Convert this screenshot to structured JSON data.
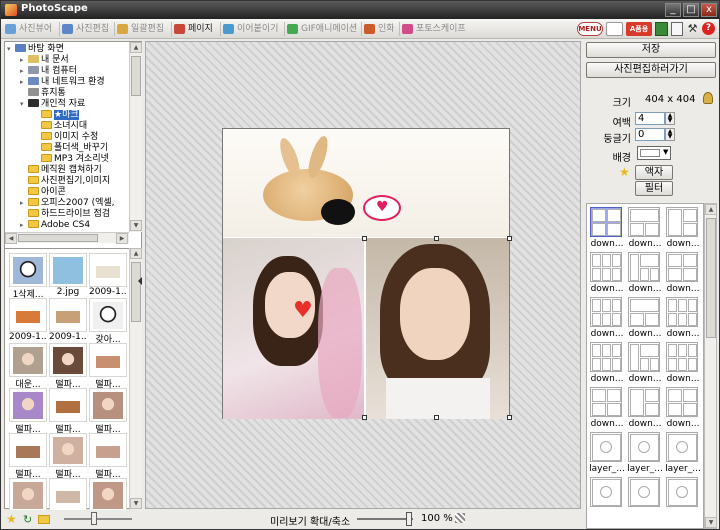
{
  "window": {
    "title": "PhotoScape",
    "controls": [
      "_",
      "□",
      "x"
    ]
  },
  "tabs": [
    {
      "label": "사진뷰어",
      "color": "#6aa0d8"
    },
    {
      "label": "사진편집",
      "color": "#5c86c8"
    },
    {
      "label": "일괄편집",
      "color": "#d9a640"
    },
    {
      "label": "페이지",
      "color": "#c8463a"
    },
    {
      "label": "이어붙이기",
      "color": "#4a9ad0"
    },
    {
      "label": "GIF애니메이션",
      "color": "#47a854"
    },
    {
      "label": "인화",
      "color": "#cc5a2a"
    },
    {
      "label": "포토스케이프",
      "color": "#d24b8a"
    }
  ],
  "toolbar_right": {
    "menu": "MENU",
    "blog": "A품용"
  },
  "tree": {
    "items": [
      {
        "label": "바탕 화면",
        "level": 0,
        "ex": "▾",
        "icon": "#5b7fc4"
      },
      {
        "label": "내 문서",
        "level": 1,
        "ex": "▸",
        "icon": "#e0c060"
      },
      {
        "label": "내 컴퓨터",
        "level": 1,
        "ex": "▸",
        "icon": "#8e98a8"
      },
      {
        "label": "내 네트워크 환경",
        "level": 1,
        "ex": "▸",
        "icon": "#6c8ac0"
      },
      {
        "label": "휴지통",
        "level": 1,
        "ex": "",
        "icon": "#909090"
      },
      {
        "label": "개인적 자료",
        "level": 1,
        "ex": "▾",
        "icon": "#2d2d2d"
      },
      {
        "label": "★마크",
        "level": 2,
        "ex": "",
        "icon": "#f2c744",
        "sel": true
      },
      {
        "label": "소녀시대",
        "level": 2,
        "ex": "",
        "icon": "#f2c744"
      },
      {
        "label": "이미지 수정",
        "level": 2,
        "ex": "",
        "icon": "#f2c744"
      },
      {
        "label": "폴더색_바꾸기",
        "level": 2,
        "ex": "",
        "icon": "#f2c744"
      },
      {
        "label": "MP3 겨소리넷",
        "level": 2,
        "ex": "",
        "icon": "#f2c744"
      },
      {
        "label": "메직원 캡쳐하기",
        "level": 1,
        "ex": "",
        "icon": "#f2c744"
      },
      {
        "label": "사진편집기,이미지",
        "level": 1,
        "ex": "",
        "icon": "#f2c744"
      },
      {
        "label": "아이콘",
        "level": 1,
        "ex": "",
        "icon": "#f2c744"
      },
      {
        "label": "오피스2007 (엑셀,",
        "level": 1,
        "ex": "▸",
        "icon": "#f2c744"
      },
      {
        "label": "하드드라이브 점검",
        "level": 1,
        "ex": "",
        "icon": "#f2c744"
      },
      {
        "label": "Adobe CS4",
        "level": 1,
        "ex": "▸",
        "icon": "#f2c744"
      }
    ]
  },
  "thumbs": [
    {
      "cap": "1삭제...",
      "color": "#9fb8d8",
      "kind": "panda"
    },
    {
      "cap": "2.jpg",
      "color": "#8fc0e0",
      "kind": "blue"
    },
    {
      "cap": "2009-1...",
      "color": "#e8e0d0",
      "kind": "small"
    },
    {
      "cap": "2009-1...",
      "color": "#d87a3a",
      "kind": "small"
    },
    {
      "cap": "2009-1...",
      "color": "#c8a078",
      "kind": "small"
    },
    {
      "cap": "갖아...",
      "color": "#f0f0f0",
      "kind": "panda"
    },
    {
      "cap": "대운...",
      "color": "#b0a090",
      "kind": "face"
    },
    {
      "cap": "떨파...",
      "color": "#6a4a3a",
      "kind": "face"
    },
    {
      "cap": "떨파...",
      "color": "#c89070",
      "kind": "small"
    },
    {
      "cap": "떨파...",
      "color": "#a888c8",
      "kind": "face"
    },
    {
      "cap": "떨파...",
      "color": "#b07040",
      "kind": "small"
    },
    {
      "cap": "떨파...",
      "color": "#b89080",
      "kind": "face"
    },
    {
      "cap": "떨파...",
      "color": "#a87858",
      "kind": "small"
    },
    {
      "cap": "떨파...",
      "color": "#d0b0a0",
      "kind": "face"
    },
    {
      "cap": "떨파...",
      "color": "#c8a090",
      "kind": "small"
    },
    {
      "cap": "",
      "color": "#c8a898",
      "kind": "face"
    },
    {
      "cap": "",
      "color": "#d0b8a8",
      "kind": "small"
    },
    {
      "cap": "",
      "color": "#c09888",
      "kind": "face"
    }
  ],
  "right": {
    "save": "저장",
    "goto_edit": "사진편집하러가기",
    "size_label": "크기",
    "size_value": "404 x 404",
    "margin_label": "여백",
    "margin_value": "4",
    "round_label": "둥글기",
    "round_value": "0",
    "bg_label": "배경",
    "frame_btn": "액자",
    "filter_btn": "필터",
    "layouts": [
      {
        "cap": "down...",
        "pat": "g4",
        "sel": true
      },
      {
        "cap": "down...",
        "pat": "g3"
      },
      {
        "cap": "down...",
        "pat": "g3b"
      },
      {
        "cap": "down...",
        "pat": "g6"
      },
      {
        "cap": "down...",
        "pat": "g4b"
      },
      {
        "cap": "down...",
        "pat": "g4"
      },
      {
        "cap": "down...",
        "pat": "g6"
      },
      {
        "cap": "down...",
        "pat": "g3"
      },
      {
        "cap": "down...",
        "pat": "g6"
      },
      {
        "cap": "down...",
        "pat": "g6"
      },
      {
        "cap": "down...",
        "pat": "g4b"
      },
      {
        "cap": "down...",
        "pat": "g6"
      },
      {
        "cap": "down...",
        "pat": "g4"
      },
      {
        "cap": "down...",
        "pat": "g3b"
      },
      {
        "cap": "down...",
        "pat": "g4"
      },
      {
        "cap": "layer_...",
        "pat": "circ"
      },
      {
        "cap": "layer_...",
        "pat": "circ"
      },
      {
        "cap": "layer_...",
        "pat": "circ"
      },
      {
        "cap": "",
        "pat": "circ"
      },
      {
        "cap": "",
        "pat": "circ"
      },
      {
        "cap": "",
        "pat": "circ"
      }
    ]
  },
  "bottom": {
    "zoom_label": "미리보기 확대/축소",
    "zoom_value": "100 %"
  }
}
